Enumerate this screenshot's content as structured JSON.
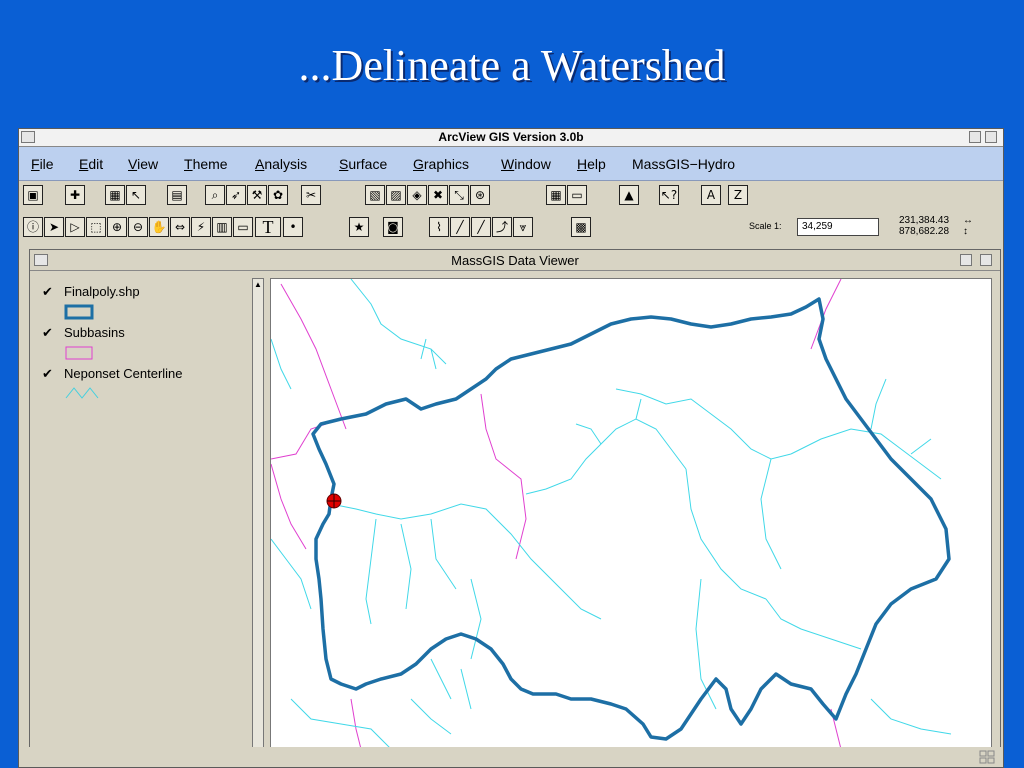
{
  "slide": {
    "title": "...Delineate a Watershed"
  },
  "app": {
    "title": "ArcView GIS Version 3.0b"
  },
  "menu": [
    {
      "label": "File",
      "key": "F",
      "rest": "ile"
    },
    {
      "label": "Edit",
      "key": "E",
      "rest": "dit"
    },
    {
      "label": "View",
      "key": "V",
      "rest": "iew"
    },
    {
      "label": "Theme",
      "key": "T",
      "rest": "heme"
    },
    {
      "label": "Analysis",
      "key": "A",
      "rest": "nalysis"
    },
    {
      "label": "Surface",
      "key": "S",
      "rest": "urface"
    },
    {
      "label": "Graphics",
      "key": "G",
      "rest": "raphics"
    },
    {
      "label": "Window",
      "key": "W",
      "rest": "indow"
    },
    {
      "label": "Help",
      "key": "H",
      "rest": "elp"
    },
    {
      "label": "MassGIS-Hydro",
      "key": "",
      "rest": "MassGIS−Hydro"
    }
  ],
  "toolbar": {
    "help_tool": "?",
    "a_button": "A",
    "z_button": "Z",
    "text_tool": "T"
  },
  "scale": {
    "label": "Scale 1:",
    "value": "34,259"
  },
  "coords": {
    "x": "231,384.43",
    "y": "878,682.28"
  },
  "viewer": {
    "title": "MassGIS Data Viewer"
  },
  "layers": [
    {
      "name": "Finalpoly.shp",
      "color": "#1d6fa5"
    },
    {
      "name": "Subbasins",
      "color": "#e040d0"
    },
    {
      "name": "Neponset Centerline",
      "color": "#40d0e0"
    }
  ],
  "colors": {
    "watershed": "#1d6fa5",
    "subbasin": "#e040d0",
    "stream": "#40d8e8",
    "outlet": "#e00000"
  }
}
